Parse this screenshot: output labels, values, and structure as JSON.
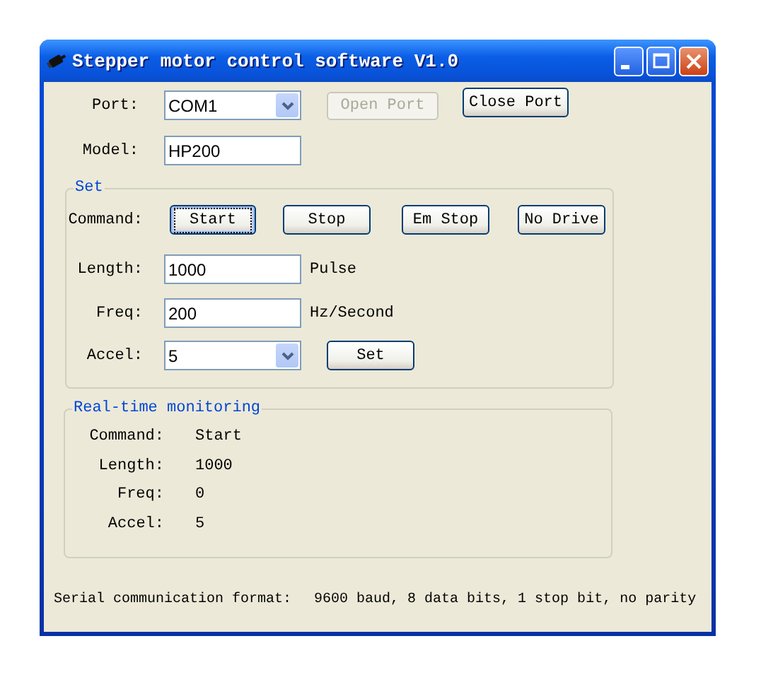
{
  "window": {
    "title": "Stepper motor control software V1.0"
  },
  "connection": {
    "port": {
      "label": "Port:",
      "value": "COM1"
    },
    "open_port": {
      "label": "Open Port",
      "disabled": true
    },
    "close_port": {
      "label": "Close Port",
      "disabled": false
    },
    "model": {
      "label": "Model:",
      "value": "HP200"
    }
  },
  "set": {
    "title": "Set",
    "command_label": "Command:",
    "commands": [
      {
        "label": "Start",
        "focused": true
      },
      {
        "label": "Stop",
        "focused": false
      },
      {
        "label": "Em Stop",
        "focused": false
      },
      {
        "label": "No Drive",
        "focused": false
      }
    ],
    "length": {
      "label": "Length:",
      "value": "1000",
      "unit": "Pulse"
    },
    "freq": {
      "label": "Freq:",
      "value": "200",
      "unit": "Hz/Second"
    },
    "accel": {
      "label": "Accel:",
      "value": "5"
    },
    "set_button": {
      "label": "Set"
    }
  },
  "monitoring": {
    "title": "Real-time monitoring",
    "rows": [
      {
        "label": "Command:",
        "value": "Start"
      },
      {
        "label": "Length:",
        "value": "1000"
      },
      {
        "label": "Freq:",
        "value": "0"
      },
      {
        "label": "Accel:",
        "value": "5"
      }
    ]
  },
  "status": {
    "label": "Serial communication format:",
    "value": "9600 baud, 8 data bits, 1 stop bit, no parity"
  }
}
